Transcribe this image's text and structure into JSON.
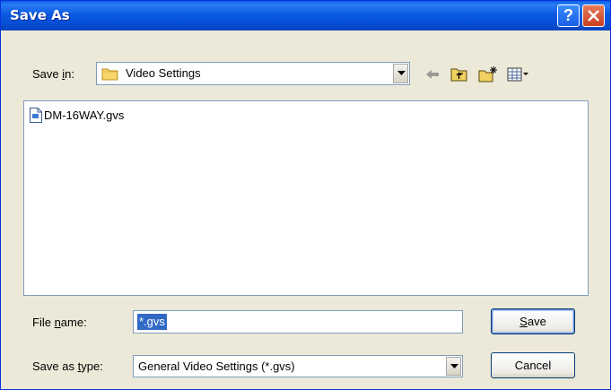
{
  "window": {
    "title": "Save As"
  },
  "title_buttons": {
    "help": "?"
  },
  "save_in": {
    "label_prefix": "Save ",
    "label_accel": "i",
    "label_suffix": "n:",
    "value": "Video Settings"
  },
  "toolbar": {
    "icons": [
      "back-arrow-icon",
      "up-folder-icon",
      "new-folder-icon",
      "view-menu-icon"
    ]
  },
  "files": [
    {
      "name": "DM-16WAY.gvs",
      "icon": "gvs-file-icon"
    }
  ],
  "file_name": {
    "label_prefix": "File ",
    "label_accel": "n",
    "label_suffix": "ame:",
    "value": "*.gvs"
  },
  "save_as_type": {
    "label_prefix": "Save as ",
    "label_accel": "t",
    "label_suffix": "ype:",
    "value": "General Video Settings (*.gvs)"
  },
  "buttons": {
    "save_accel": "S",
    "save_rest": "ave",
    "cancel": "Cancel"
  }
}
